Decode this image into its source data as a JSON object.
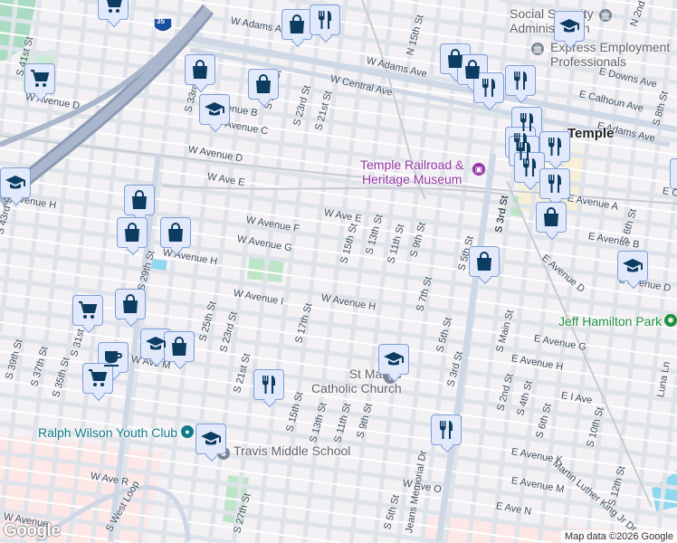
{
  "map": {
    "markers": {
      "icons": [
        "shopping-cart",
        "shopping-bag",
        "restaurant",
        "school",
        "cafe"
      ]
    },
    "avenue_labels": [
      "W Adams Ave",
      "W Adams Ave",
      "W Central Ave",
      "E Adams Ave",
      "W Avenue B",
      "W Avenue C",
      "W Avenue D",
      "W Avenue D",
      "W Ave E",
      "W Ave E",
      "W Avenue F",
      "W Avenue G",
      "W Avenue H",
      "W Avenue H",
      "W Avenue I",
      "W Avenue H",
      "E Avenue A",
      "E Avenue B",
      "E Avenue D",
      "E Avenue D",
      "E Avenue G",
      "E Avenue H",
      "E I Ave",
      "E Avenue K",
      "E Avenue M",
      "E Ave N",
      "W Ave O",
      "W Ave R",
      "W Ave M",
      "E Calhoun Ave",
      "E Downs Ave",
      "W Avenue",
      "S West Loop",
      "Martin Luther King Jr Dr",
      "Luna Ln",
      "E C"
    ],
    "street_labels": [
      "S 41st St",
      "S 33rd St",
      "S 25th St",
      "S 23rd St",
      "S 21st St",
      "S 43rd St",
      "S 29th St",
      "S 25th St",
      "S 23rd St",
      "S 21st St",
      "S 17th St",
      "S 15th St",
      "S 13th St",
      "S 11th St",
      "S 9th St",
      "S 15th St",
      "S 13th St",
      "S 11th St",
      "S 9th St",
      "S 7th St",
      "S 5th St",
      "S 3rd St",
      "S 5th St",
      "S 3rd St",
      "S Main St",
      "S 2nd St",
      "S 4th St",
      "S 6th St",
      "S 10th St",
      "S 12th St",
      "N 15th St",
      "S 39th St",
      "S 37th St",
      "S 35th St",
      "S 5th St",
      "S 8th St",
      "S 6th St",
      "N 2nd St",
      "S 31st St",
      "Jeans Memorial Dr",
      "S 27th St"
    ],
    "highway_shield": "35",
    "city_label": "Temple",
    "pois": {
      "ssa": "Social Security Administration",
      "express": "Express Employment Professionals",
      "museum_line1": "Temple Railroad &",
      "museum_line2": "Heritage Museum",
      "park": "Jeff Hamilton Park",
      "church_line1": "St Mary's",
      "church_line2": "Catholic Church",
      "youth_club": "Ralph Wilson Youth Club",
      "travis": "Travis Middle School"
    },
    "attribution": "Map data ©2026 Google",
    "logo": "Google",
    "colors": {
      "marker_bg": "#e1e9fb",
      "marker_icon": "#0d3c61",
      "museum": "#9334a3",
      "park": "#1e8e3e",
      "poi_grey": "#5f6368",
      "youth_club": "#137a8a"
    }
  }
}
